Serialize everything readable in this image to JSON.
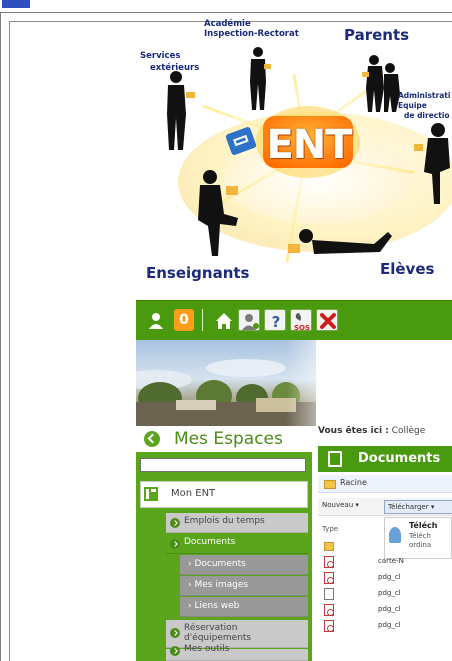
{
  "illustration": {
    "labels": {
      "academie": "Académie",
      "inspection": "Inspection-Rectorat",
      "parents": "Parents",
      "services": "Services",
      "exterieurs": "extérieurs",
      "administration": "Administrati",
      "equipe": "Equipe",
      "direction": "de directio",
      "enseignants": "Enseignants",
      "eleves": "Elèves",
      "ent": "ENT"
    }
  },
  "toolbar": {
    "notification_count": "0"
  },
  "sidebar": {
    "title": "Mes Espaces",
    "mon_ent": "Mon ENT",
    "items": [
      {
        "label": "Emplois du temps"
      },
      {
        "label": "Documents"
      },
      {
        "label": "Réservation d'équipements"
      },
      {
        "label": "Mes outils"
      }
    ],
    "subitems": [
      {
        "label": "Documents"
      },
      {
        "label": "Mes images"
      },
      {
        "label": "Liens web"
      }
    ]
  },
  "content": {
    "breadcrumb_label": "Vous êtes ici :",
    "breadcrumb_value": "Collège",
    "panel_title": "Documents",
    "root_label": "Racine",
    "new_button": "Nouveau",
    "download_button": "Télécharger",
    "tooltip_title": "Téléch",
    "tooltip_line1": "Téléch",
    "tooltip_line2": "ordina",
    "type_header": "Type",
    "files": [
      {
        "type": "folder",
        "name": ""
      },
      {
        "type": "pdf",
        "name": "carte-N"
      },
      {
        "type": "pdf",
        "name": "pdg_cl"
      },
      {
        "type": "doc",
        "name": "pdg_cl"
      },
      {
        "type": "pdf",
        "name": "pdg_cl"
      },
      {
        "type": "pdf",
        "name": "pdg_cl"
      }
    ]
  },
  "colors": {
    "ent_green": "#5aa51c",
    "ent_orange": "#ff7a00",
    "label_blue": "#1b2a7a"
  }
}
